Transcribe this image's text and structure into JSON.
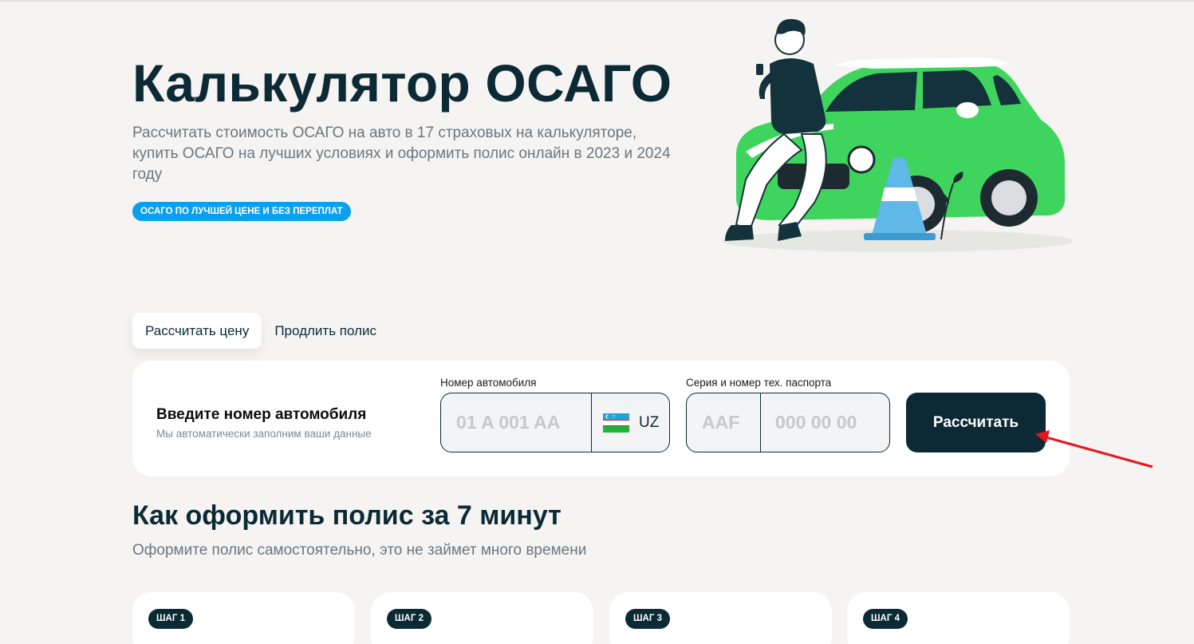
{
  "hero": {
    "title": "Калькулятор ОСАГО",
    "subtitle": "Рассчитать стоимость ОСАГО на авто в 17 страховых на калькуляторе, купить ОСАГО на лучших условиях и оформить полис онлайн в 2023 и 2024 году",
    "badge": "ОСАГО ПО ЛУЧШЕЙ ЦЕНЕ И БЕЗ ПЕРЕПЛАТ",
    "illustration": "man-leaning-on-green-car-with-traffic-cone"
  },
  "tabs": [
    {
      "label": "Рассчитать цену",
      "active": true
    },
    {
      "label": "Продлить полис",
      "active": false
    }
  ],
  "calculator": {
    "heading": "Введите номер автомобиля",
    "hint": "Мы автоматически заполним ваши данные",
    "plate": {
      "label": "Номер автомобиля",
      "placeholder": "01 A 001 AA",
      "region_code": "UZ",
      "flag_icon": "uzbekistan-flag-icon"
    },
    "passport": {
      "label": "Серия и номер тех. паспорта",
      "series_placeholder": "AAF",
      "number_placeholder": "000 00 00"
    },
    "button_label": "Рассчитать"
  },
  "how_to": {
    "title": "Как оформить полис за 7 минут",
    "subtitle": "Оформите полис самостоятельно, это не займет много времени",
    "steps": [
      {
        "badge": "ШАГ 1"
      },
      {
        "badge": "ШАГ 2"
      },
      {
        "badge": "ШАГ 3"
      },
      {
        "badge": "ШАГ 4"
      }
    ]
  },
  "colors": {
    "brand_dark": "#0c2a35",
    "badge_blue": "#0aa0f0",
    "background": "#f5f4f2",
    "annotation_arrow": "#e8141c"
  }
}
